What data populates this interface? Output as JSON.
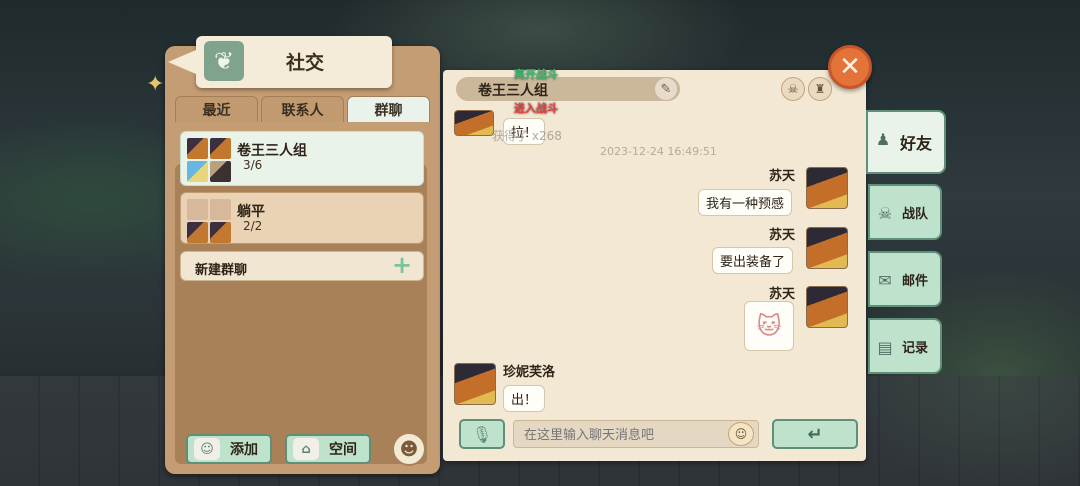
{
  "panel": {
    "title": "社交"
  },
  "tabs": [
    {
      "label": "最近",
      "active": false
    },
    {
      "label": "联系人",
      "active": false
    },
    {
      "label": "群聊",
      "active": true
    }
  ],
  "groups": [
    {
      "name": "卷王三人组",
      "count": "3/6",
      "selected": true
    },
    {
      "name": "躺平",
      "count": "2/2",
      "selected": false
    }
  ],
  "new_group_label": "新建群聊",
  "bottom_buttons": {
    "add_label": "添加",
    "space_label": "空间"
  },
  "chat": {
    "title": "卷王三人组",
    "battle_left": "离开战斗",
    "battle_enter": "进入战斗",
    "first_message": "拉！",
    "reward_text": "获得了",
    "reward_count": "x268",
    "timestamp": "2023-12-24 16:49:51",
    "messages": [
      {
        "sender": "苏天",
        "text": "我有一种预感"
      },
      {
        "sender": "苏天",
        "text": "要出装备了"
      },
      {
        "sender": "苏天",
        "text": "[sticker]"
      },
      {
        "sender": "珍妮芙洛",
        "text": "出！"
      }
    ],
    "input_placeholder": "在这里输入聊天消息吧"
  },
  "side_tabs": [
    {
      "label": "好友"
    },
    {
      "label": "战队"
    },
    {
      "label": "邮件"
    },
    {
      "label": "记录"
    }
  ],
  "colors": {
    "accent_green": "#bfe2cd",
    "close_orange": "#e4733a",
    "paper": "#f2e8d4"
  }
}
